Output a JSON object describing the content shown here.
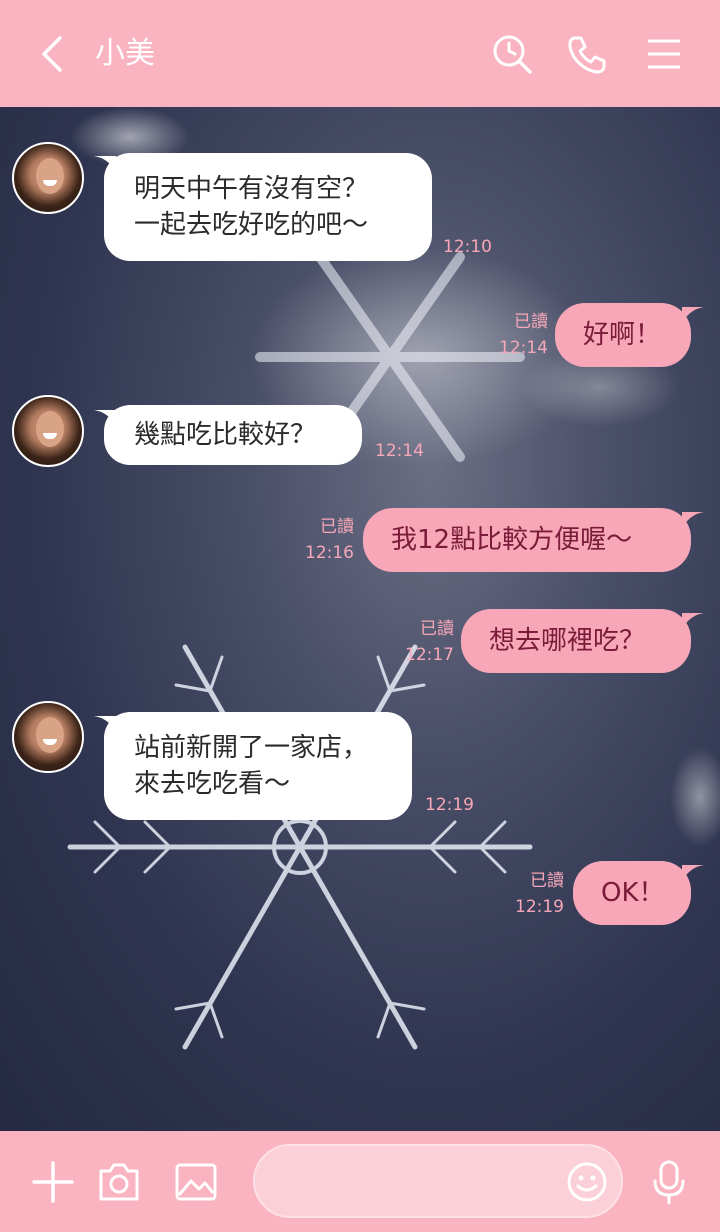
{
  "header": {
    "title": "小美"
  },
  "icons": {
    "back": "chevron-left-icon",
    "search": "search-clock-icon",
    "call": "phone-icon",
    "menu": "menu-icon",
    "add": "plus-icon",
    "camera": "camera-icon",
    "image": "image-icon",
    "emoji": "emoji-icon",
    "mic": "microphone-icon"
  },
  "colors": {
    "header": "#f9b3c1",
    "outgoing_bubble": "#f7a7b8",
    "outgoing_text": "#7a1b3a",
    "incoming_bubble": "#ffffff"
  },
  "messages": [
    {
      "from": "friend",
      "text": "明天中午有沒有空？\n一起去吃好吃的吧～",
      "time": "12:10"
    },
    {
      "from": "me",
      "text": "好啊！",
      "read": "已讀",
      "time": "12:14"
    },
    {
      "from": "friend",
      "text": "幾點吃比較好？",
      "time": "12:14"
    },
    {
      "from": "me",
      "text": "我12點比較方便喔～",
      "read": "已讀",
      "time": "12:16"
    },
    {
      "from": "me",
      "text": "想去哪裡吃？",
      "read": "已讀",
      "time": "12:17"
    },
    {
      "from": "friend",
      "text": "站前新開了一家店，\n來去吃吃看～",
      "time": "12:19"
    },
    {
      "from": "me",
      "text": "OK！",
      "read": "已讀",
      "time": "12:19"
    }
  ],
  "composer": {
    "placeholder": ""
  }
}
